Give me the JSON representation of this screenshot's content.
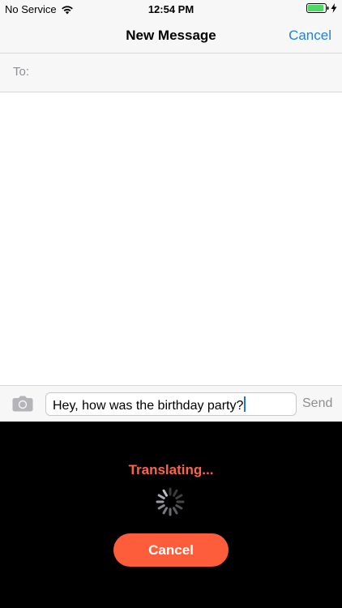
{
  "status_bar": {
    "carrier": "No Service",
    "time": "12:54 PM",
    "wifi_icon": "wifi-icon",
    "battery_icon": "battery-charging-icon"
  },
  "nav": {
    "title": "New Message",
    "cancel_label": "Cancel"
  },
  "to_field": {
    "label": "To:",
    "value": ""
  },
  "compose": {
    "camera_icon": "camera-icon",
    "message_text": "Hey, how was the birthday party?",
    "send_label": "Send"
  },
  "overlay": {
    "status_text": "Translating...",
    "spinner_icon": "activity-spinner-icon",
    "cancel_label": "Cancel"
  },
  "colors": {
    "accent_blue": "#1a82e2",
    "translating_orange": "#ff6347",
    "cancel_button_bg": "#fe5d3c",
    "overlay_bg": "#000000"
  }
}
